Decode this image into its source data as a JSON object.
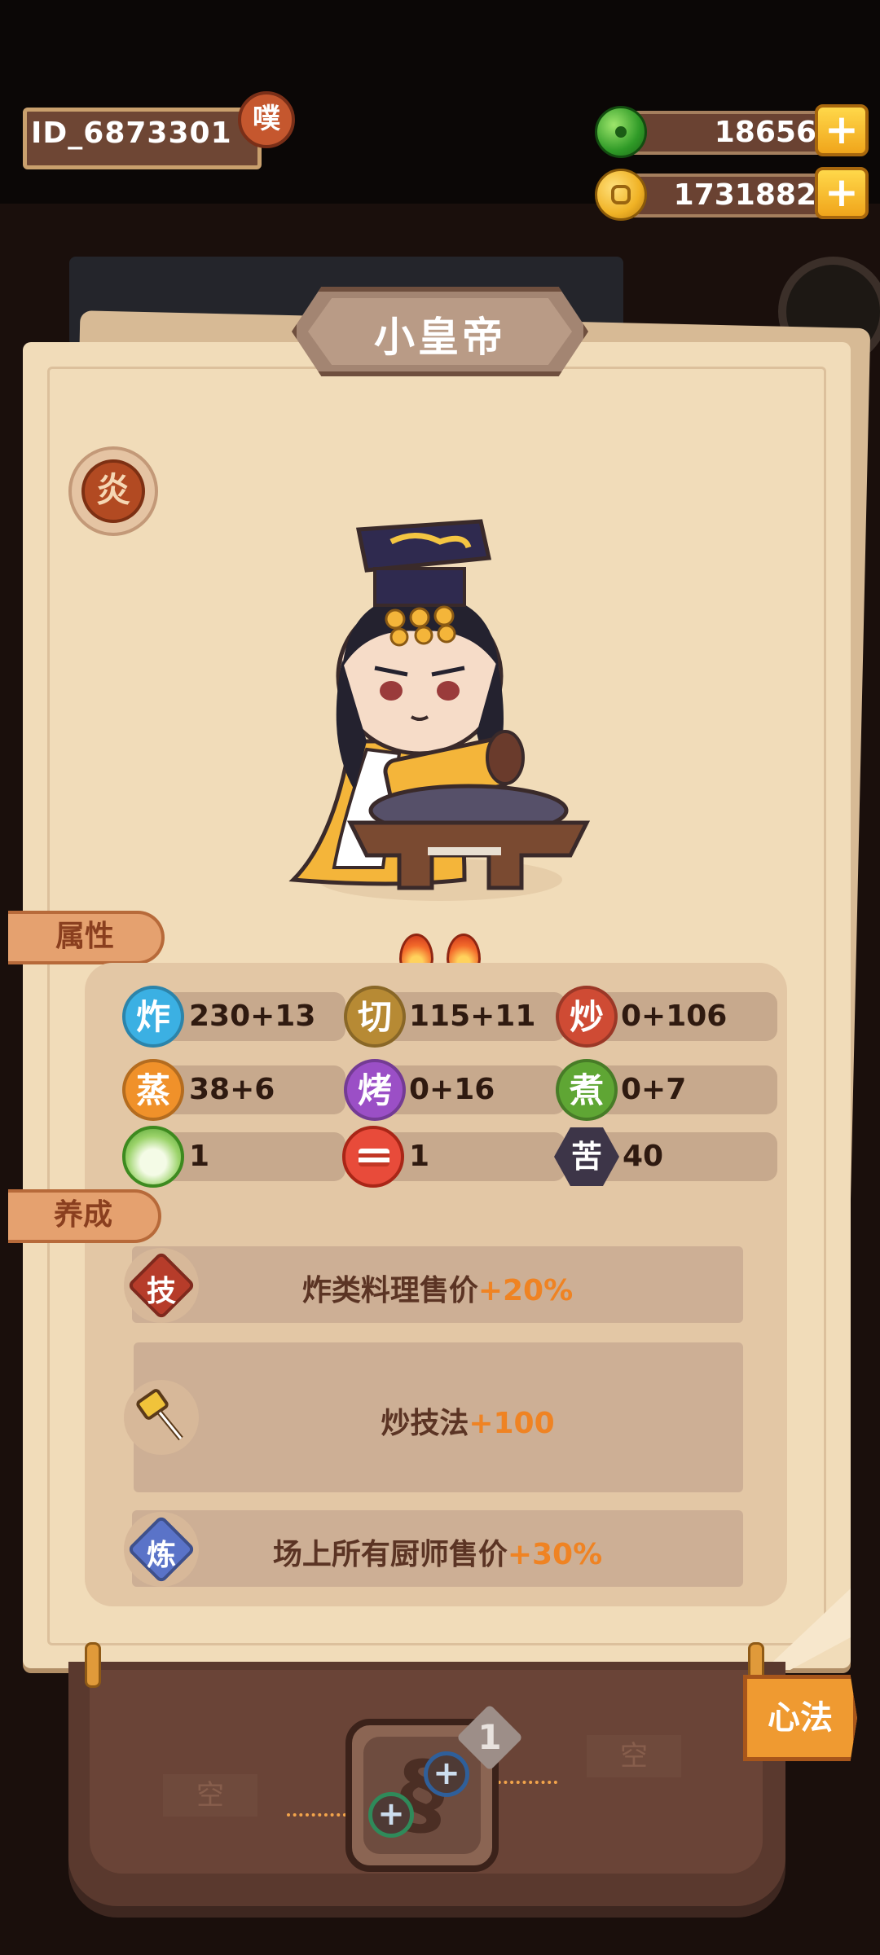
{
  "header": {
    "player_id": "ID_6873301",
    "expire_badge": "噗",
    "jade_amount": "18656",
    "coin_amount": "1731882",
    "add_symbol": "+"
  },
  "panel": {
    "title": "小皇帝",
    "skill_badge_glyph": "炎",
    "star_count": 2
  },
  "sections": {
    "attributes": "属性",
    "cultivation": "养成"
  },
  "stats": [
    {
      "icon": "炸",
      "value": "230+13",
      "color": "#3bb0e3"
    },
    {
      "icon": "切",
      "value": "115+11",
      "color": "#b78a34"
    },
    {
      "icon": "炒",
      "value": "0+106",
      "color": "#cf4b34"
    },
    {
      "icon": "蒸",
      "value": "38+6",
      "color": "#f0912a"
    },
    {
      "icon": "烤",
      "value": "0+16",
      "color": "#9b4fc6"
    },
    {
      "icon": "煮",
      "value": "0+7",
      "color": "#5fa634"
    },
    {
      "icon": "",
      "value": "1",
      "color": "#8fd35c"
    },
    {
      "icon": "",
      "value": "1",
      "color": "#e84b3a"
    },
    {
      "icon": "苦",
      "value": "40",
      "color": "#3d3548"
    }
  ],
  "cultivation": [
    {
      "icon": "技",
      "text": "炸类料理售价",
      "bonus": "+20%",
      "color": "#b63c2a"
    },
    {
      "icon": "",
      "text": "炒技法",
      "bonus": "+100",
      "color": "#f0c33a"
    },
    {
      "icon": "炼",
      "text": "场上所有厨师售价",
      "bonus": "+30%",
      "color": "#5a73c8"
    }
  ],
  "bottom": {
    "empty_left": "空",
    "empty_right": "空",
    "level": "1",
    "plus_symbol": "+",
    "xinfa_button": "心法"
  }
}
